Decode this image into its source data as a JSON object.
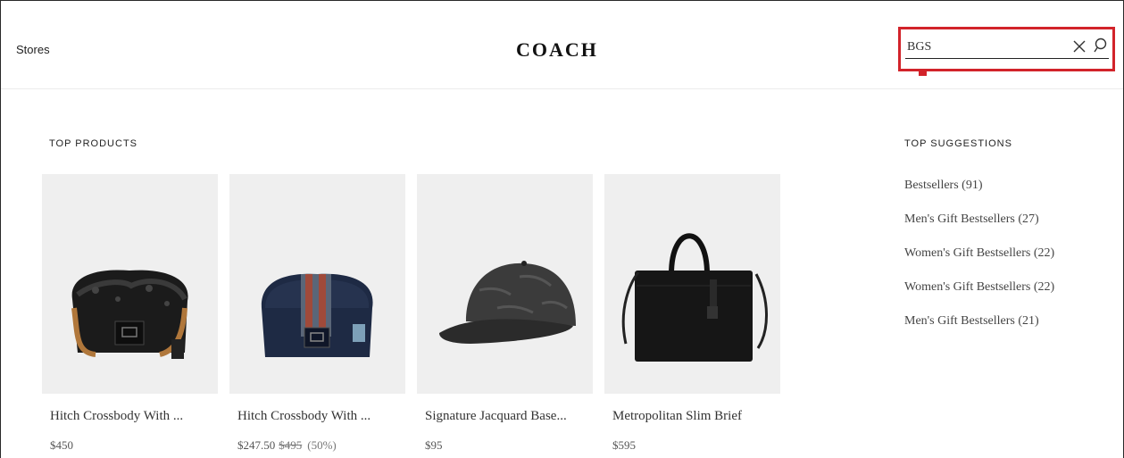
{
  "header": {
    "stores_label": "Stores",
    "logo_text": "COACH",
    "search": {
      "value": "BGS",
      "placeholder": ""
    }
  },
  "top_products": {
    "title": "TOP PRODUCTS",
    "items": [
      {
        "name": "Hitch Crossbody With ...",
        "price": "$450",
        "original_price": "",
        "discount": ""
      },
      {
        "name": "Hitch Crossbody With ...",
        "price": "$247.50",
        "original_price": "$495",
        "discount": "(50%)"
      },
      {
        "name": "Signature Jacquard Base...",
        "price": "$95",
        "original_price": "",
        "discount": ""
      },
      {
        "name": "Metropolitan Slim Brief",
        "price": "$595",
        "original_price": "",
        "discount": ""
      }
    ]
  },
  "top_suggestions": {
    "title": "TOP SUGGESTIONS",
    "items": [
      "Bestsellers (91)",
      "Men's Gift Bestsellers (27)",
      "Women's Gift Bestsellers (22)",
      "Women's Gift Bestsellers (22)",
      "Men's Gift Bestsellers (21)"
    ]
  },
  "colors": {
    "highlight": "#d2232a",
    "tile_bg": "#efefef"
  },
  "icons": {
    "clear": "close-icon",
    "search": "search-icon"
  }
}
